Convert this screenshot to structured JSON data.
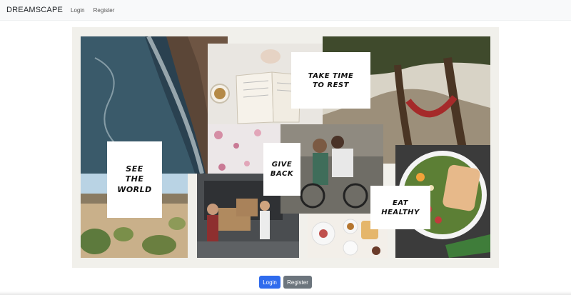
{
  "navbar": {
    "brand": "DREAMSCAPE",
    "links": [
      "Login",
      "Register"
    ]
  },
  "moodboard": {
    "cards": {
      "see_world": "SEE\nTHE\nWORLD",
      "take_time": "TAKE TIME\nTO REST",
      "give_back": "GIVE\nBACK",
      "eat_healthy": "EAT\nHEALTHY"
    },
    "photos": [
      "ocean-coast",
      "desert-plants",
      "book-and-coffee",
      "hammock-trees",
      "flower-petals",
      "volunteers",
      "cycling-friends",
      "breakfast-table",
      "salad-bowl"
    ]
  },
  "actions": {
    "login": "Login",
    "register": "Register"
  }
}
